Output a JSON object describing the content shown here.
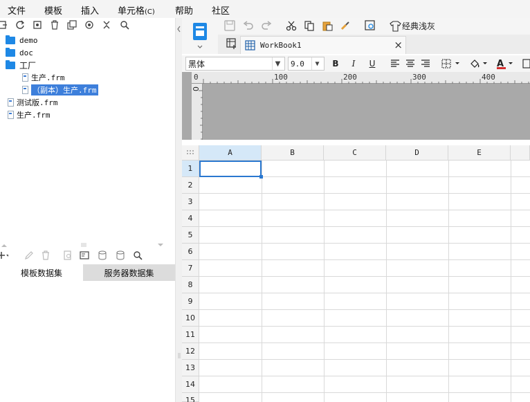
{
  "menubar": {
    "items": [
      "文件",
      "模板",
      "插入",
      "单元格",
      "帮助",
      "社区"
    ],
    "cell_shortcut": "(C)"
  },
  "left_toolbar": {
    "icons": [
      "export-icon",
      "refresh-icon",
      "settings-icon",
      "delete-icon",
      "copy-icon",
      "locate-icon",
      "collapse-icon",
      "search-icon"
    ]
  },
  "tree": {
    "items": [
      {
        "label": "demo",
        "type": "folder"
      },
      {
        "label": "doc",
        "type": "folder"
      },
      {
        "label": "工厂",
        "type": "folder"
      },
      {
        "label": "生产.frm",
        "type": "file"
      },
      {
        "label": "（副本）生产.frm",
        "type": "file",
        "selected": true
      },
      {
        "label": "测试版.frm",
        "type": "file"
      },
      {
        "label": "生产.frm",
        "type": "file"
      }
    ]
  },
  "dataset_panel": {
    "tabs": [
      "模板数据集",
      "服务器数据集"
    ],
    "active_tab": 0
  },
  "main_toolbar": {
    "theme_label": "经典浅灰"
  },
  "workbook_tab": {
    "title": "WorkBook1",
    "close": "×"
  },
  "format_bar": {
    "font_name": "黑体",
    "font_size": "9.0",
    "bold": "B",
    "italic": "I",
    "underline": "U",
    "font_color_label": "A",
    "font_color": "#d32f2f"
  },
  "ruler": {
    "marks": [
      "0",
      "100",
      "200",
      "300",
      "400"
    ],
    "vertical_mark": "0"
  },
  "grid": {
    "columns": [
      "A",
      "B",
      "C",
      "D",
      "E"
    ],
    "rows": [
      "1",
      "2",
      "3",
      "4",
      "5",
      "6",
      "7",
      "8",
      "9",
      "10",
      "11",
      "12",
      "13",
      "14",
      "15"
    ],
    "selected_cell": "A1"
  },
  "colors": {
    "accent": "#2a78d0",
    "folder": "#1e88e5",
    "selection_bg": "#3d7fdb"
  }
}
